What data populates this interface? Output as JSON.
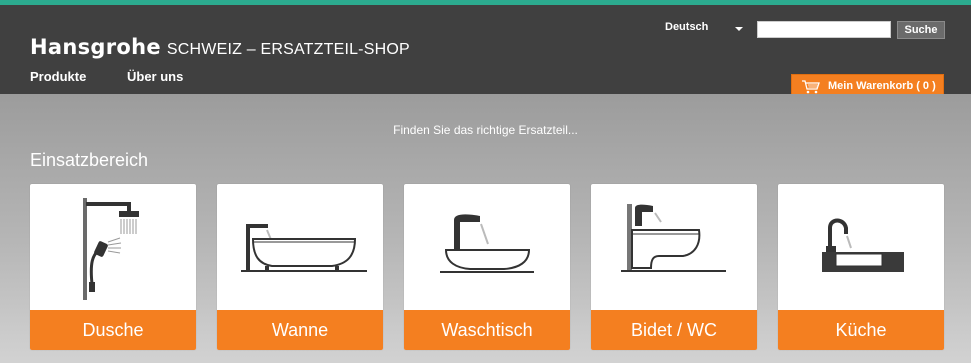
{
  "brand": {
    "name": "Hansgrohe",
    "subtitle": "SCHWEIZ – ERSATZTEIL-SHOP"
  },
  "nav": [
    {
      "label": "Produkte"
    },
    {
      "label": "Über uns"
    }
  ],
  "language": {
    "selected": "Deutsch"
  },
  "search": {
    "placeholder": "",
    "button_label": "Suche"
  },
  "cart": {
    "label": "Mein Warenkorb ( 0 )"
  },
  "main": {
    "tagline": "Finden Sie das richtige Ersatzteil...",
    "section_title": "Einsatzbereich",
    "categories": [
      {
        "label": "Dusche",
        "icon": "shower-icon"
      },
      {
        "label": "Wanne",
        "icon": "bathtub-icon"
      },
      {
        "label": "Waschtisch",
        "icon": "washbasin-icon"
      },
      {
        "label": "Bidet / WC",
        "icon": "bidet-wc-icon"
      },
      {
        "label": "Küche",
        "icon": "kitchen-sink-icon"
      }
    ]
  },
  "colors": {
    "accent": "#f47f20",
    "header_bg": "#404040",
    "top_line": "#2cab8f",
    "content_bg": "#a3a3a3"
  }
}
